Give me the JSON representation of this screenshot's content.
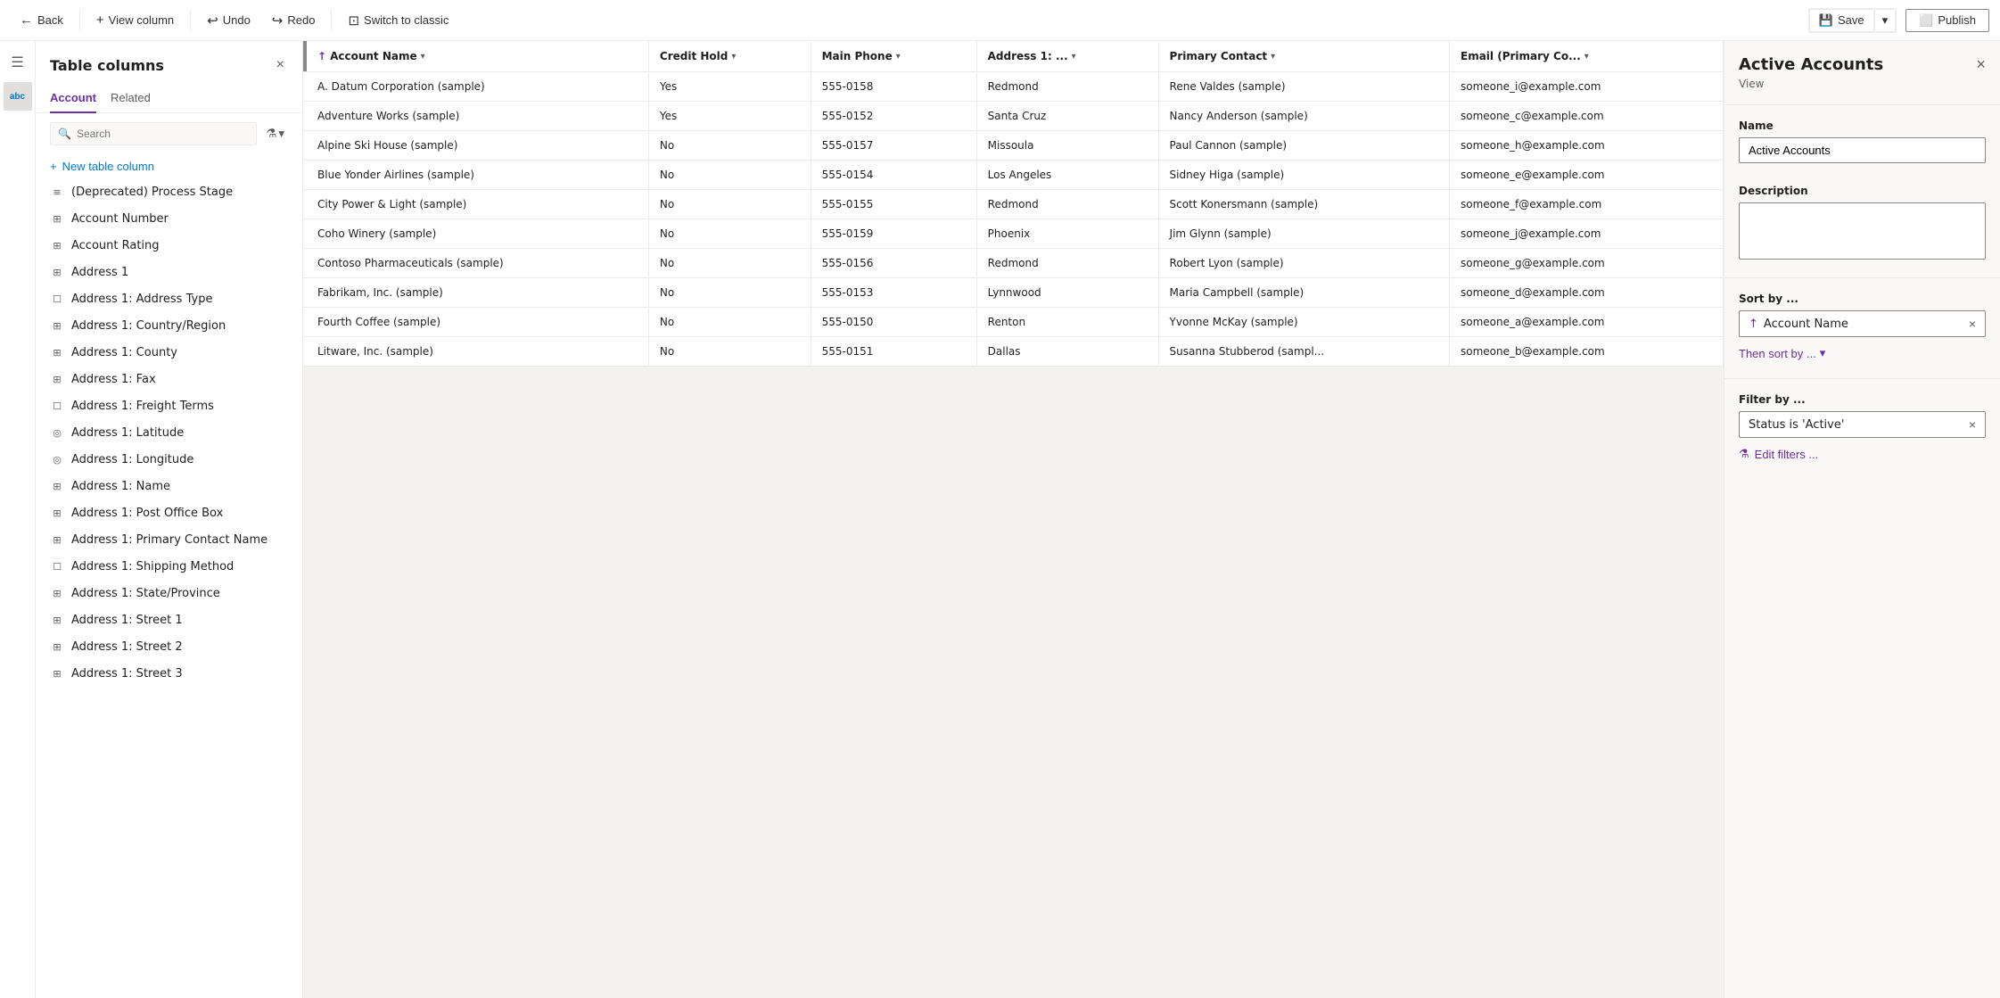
{
  "topbar": {
    "back_label": "Back",
    "view_column_label": "View column",
    "undo_label": "Undo",
    "redo_label": "Redo",
    "switch_classic_label": "Switch to classic",
    "save_label": "Save",
    "publish_label": "Publish"
  },
  "sidebar": {
    "title": "Table columns",
    "close_icon": "×",
    "tabs": [
      {
        "id": "account",
        "label": "Account",
        "active": true
      },
      {
        "id": "related",
        "label": "Related",
        "active": false
      }
    ],
    "search_placeholder": "Search",
    "new_column_label": "New table column",
    "items": [
      {
        "id": "deprecated-process-stage",
        "label": "(Deprecated) Process Stage",
        "icon": "list"
      },
      {
        "id": "account-number",
        "label": "Account Number",
        "icon": "text"
      },
      {
        "id": "account-rating",
        "label": "Account Rating",
        "icon": "text"
      },
      {
        "id": "address-1",
        "label": "Address 1",
        "icon": "text"
      },
      {
        "id": "address-1-type",
        "label": "Address 1: Address Type",
        "icon": "box"
      },
      {
        "id": "address-1-country",
        "label": "Address 1: Country/Region",
        "icon": "grid"
      },
      {
        "id": "address-1-county",
        "label": "Address 1: County",
        "icon": "grid"
      },
      {
        "id": "address-1-fax",
        "label": "Address 1: Fax",
        "icon": "grid"
      },
      {
        "id": "address-1-freight",
        "label": "Address 1: Freight Terms",
        "icon": "box"
      },
      {
        "id": "address-1-latitude",
        "label": "Address 1: Latitude",
        "icon": "circle"
      },
      {
        "id": "address-1-longitude",
        "label": "Address 1: Longitude",
        "icon": "circle"
      },
      {
        "id": "address-1-name",
        "label": "Address 1: Name",
        "icon": "grid"
      },
      {
        "id": "address-1-pobox",
        "label": "Address 1: Post Office Box",
        "icon": "grid"
      },
      {
        "id": "address-1-primary-contact",
        "label": "Address 1: Primary Contact Name",
        "icon": "grid"
      },
      {
        "id": "address-1-shipping",
        "label": "Address 1: Shipping Method",
        "icon": "box"
      },
      {
        "id": "address-1-state",
        "label": "Address 1: State/Province",
        "icon": "grid"
      },
      {
        "id": "address-1-street1",
        "label": "Address 1: Street 1",
        "icon": "grid"
      },
      {
        "id": "address-1-street2",
        "label": "Address 1: Street 2",
        "icon": "grid"
      },
      {
        "id": "address-1-street3",
        "label": "Address 1: Street 3",
        "icon": "grid"
      }
    ]
  },
  "table": {
    "columns": [
      {
        "id": "account-name",
        "label": "Account Name",
        "sortable": true,
        "sort": "asc"
      },
      {
        "id": "credit-hold",
        "label": "Credit Hold",
        "sortable": true
      },
      {
        "id": "main-phone",
        "label": "Main Phone",
        "sortable": true
      },
      {
        "id": "address1",
        "label": "Address 1: ...",
        "sortable": true
      },
      {
        "id": "primary-contact",
        "label": "Primary Contact",
        "sortable": true
      },
      {
        "id": "email",
        "label": "Email (Primary Co...",
        "sortable": true
      }
    ],
    "rows": [
      {
        "account_name": "A. Datum Corporation (sample)",
        "credit_hold": "Yes",
        "main_phone": "555-0158",
        "address": "Redmond",
        "primary_contact": "Rene Valdes (sample)",
        "email": "someone_i@example.com"
      },
      {
        "account_name": "Adventure Works (sample)",
        "credit_hold": "Yes",
        "main_phone": "555-0152",
        "address": "Santa Cruz",
        "primary_contact": "Nancy Anderson (sample)",
        "email": "someone_c@example.com"
      },
      {
        "account_name": "Alpine Ski House (sample)",
        "credit_hold": "No",
        "main_phone": "555-0157",
        "address": "Missoula",
        "primary_contact": "Paul Cannon (sample)",
        "email": "someone_h@example.com"
      },
      {
        "account_name": "Blue Yonder Airlines (sample)",
        "credit_hold": "No",
        "main_phone": "555-0154",
        "address": "Los Angeles",
        "primary_contact": "Sidney Higa (sample)",
        "email": "someone_e@example.com"
      },
      {
        "account_name": "City Power & Light (sample)",
        "credit_hold": "No",
        "main_phone": "555-0155",
        "address": "Redmond",
        "primary_contact": "Scott Konersmann (sample)",
        "email": "someone_f@example.com"
      },
      {
        "account_name": "Coho Winery (sample)",
        "credit_hold": "No",
        "main_phone": "555-0159",
        "address": "Phoenix",
        "primary_contact": "Jim Glynn (sample)",
        "email": "someone_j@example.com"
      },
      {
        "account_name": "Contoso Pharmaceuticals (sample)",
        "credit_hold": "No",
        "main_phone": "555-0156",
        "address": "Redmond",
        "primary_contact": "Robert Lyon (sample)",
        "email": "someone_g@example.com"
      },
      {
        "account_name": "Fabrikam, Inc. (sample)",
        "credit_hold": "No",
        "main_phone": "555-0153",
        "address": "Lynnwood",
        "primary_contact": "Maria Campbell (sample)",
        "email": "someone_d@example.com"
      },
      {
        "account_name": "Fourth Coffee (sample)",
        "credit_hold": "No",
        "main_phone": "555-0150",
        "address": "Renton",
        "primary_contact": "Yvonne McKay (sample)",
        "email": "someone_a@example.com"
      },
      {
        "account_name": "Litware, Inc. (sample)",
        "credit_hold": "No",
        "main_phone": "555-0151",
        "address": "Dallas",
        "primary_contact": "Susanna Stubberod (sampl...",
        "email": "someone_b@example.com"
      }
    ]
  },
  "right_panel": {
    "title": "Active Accounts",
    "close_icon": "×",
    "subtitle": "View",
    "name_label": "Name",
    "name_value": "Active Accounts",
    "description_label": "Description",
    "description_placeholder": "",
    "sort_label": "Sort by ...",
    "sort_field": "Account Name",
    "sort_remove": "×",
    "then_sort_label": "Then sort by ...",
    "filter_label": "Filter by ...",
    "filter_value": "Status is 'Active'",
    "filter_remove": "×",
    "edit_filters_label": "Edit filters ..."
  },
  "icons": {
    "back": "←",
    "view_column": "+",
    "undo": "↩",
    "redo": "↪",
    "switch": "⊡",
    "save": "💾",
    "publish": "⬜",
    "hamburger": "≡",
    "abc": "abc",
    "search": "🔍",
    "filter": "▾",
    "chevron_down": "▾",
    "sort_asc": "↑",
    "sort_desc": "↓",
    "close": "×",
    "list_icon": "≡",
    "text_icon": "⊞",
    "box_icon": "☐",
    "grid_icon": "⊞",
    "circle_icon": "◎",
    "plus": "+",
    "funnel": "⚗",
    "arrow_up": "↑"
  }
}
